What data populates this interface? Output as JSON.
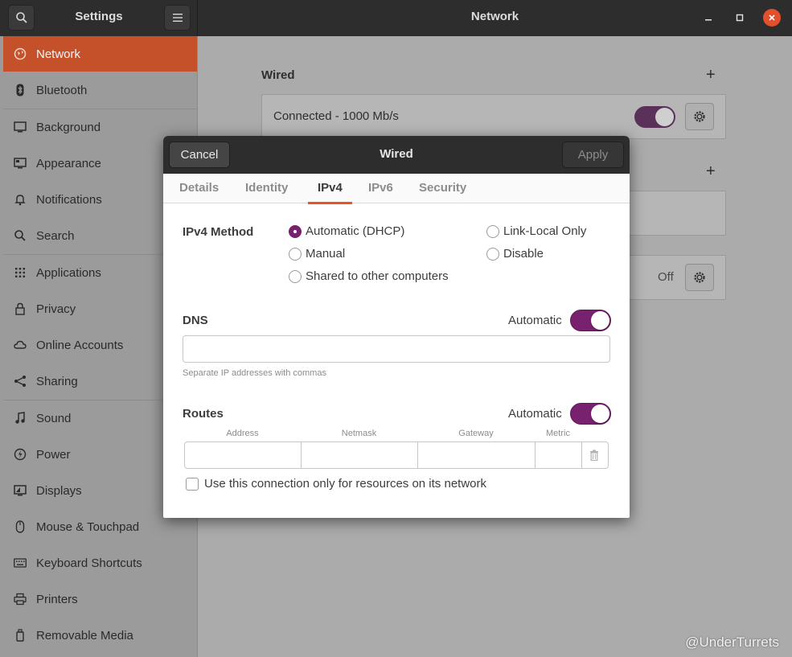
{
  "app": {
    "title": "Settings",
    "panel_title": "Network"
  },
  "sidebar": {
    "items": [
      {
        "label": "Network",
        "icon": "network-icon",
        "active": true
      },
      {
        "label": "Bluetooth",
        "icon": "bluetooth-icon"
      },
      {
        "label": "Background",
        "icon": "monitor-icon"
      },
      {
        "label": "Appearance",
        "icon": "appearance-icon"
      },
      {
        "label": "Notifications",
        "icon": "bell-icon"
      },
      {
        "label": "Search",
        "icon": "search-icon"
      },
      {
        "label": "Applications",
        "icon": "apps-grid-icon"
      },
      {
        "label": "Privacy",
        "icon": "lock-icon"
      },
      {
        "label": "Online Accounts",
        "icon": "cloud-icon"
      },
      {
        "label": "Sharing",
        "icon": "share-icon"
      },
      {
        "label": "Sound",
        "icon": "music-note-icon"
      },
      {
        "label": "Power",
        "icon": "power-icon"
      },
      {
        "label": "Displays",
        "icon": "display-icon"
      },
      {
        "label": "Mouse & Touchpad",
        "icon": "mouse-icon"
      },
      {
        "label": "Keyboard Shortcuts",
        "icon": "keyboard-icon"
      },
      {
        "label": "Printers",
        "icon": "printer-icon"
      },
      {
        "label": "Removable Media",
        "icon": "usb-drive-icon"
      }
    ]
  },
  "main": {
    "wired_title": "Wired",
    "wired_status": "Connected - 1000 Mb/s",
    "proxy_status": "Off"
  },
  "dialog": {
    "title": "Wired",
    "cancel_label": "Cancel",
    "apply_label": "Apply",
    "tabs": [
      "Details",
      "Identity",
      "IPv4",
      "IPv6",
      "Security"
    ],
    "active_tab": "IPv4",
    "ipv4_method_label": "IPv4 Method",
    "methods": {
      "automatic": "Automatic (DHCP)",
      "manual": "Manual",
      "shared": "Shared to other computers",
      "link_local": "Link-Local Only",
      "disable": "Disable"
    },
    "selected_method": "Automatic (DHCP)",
    "dns_label": "DNS",
    "dns_automatic_label": "Automatic",
    "dns_automatic": true,
    "dns_value": "",
    "dns_hint": "Separate IP addresses with commas",
    "routes_label": "Routes",
    "routes_automatic_label": "Automatic",
    "routes_automatic": true,
    "routes_columns": [
      "Address",
      "Netmask",
      "Gateway",
      "Metric"
    ],
    "only_resources_label": "Use this connection only for resources on its network",
    "only_resources_checked": false
  },
  "colors": {
    "accent": "#e95420",
    "toggle_on": "#77216f",
    "sidebar_active": "#c4512a"
  },
  "watermark": "@UnderTurrets"
}
